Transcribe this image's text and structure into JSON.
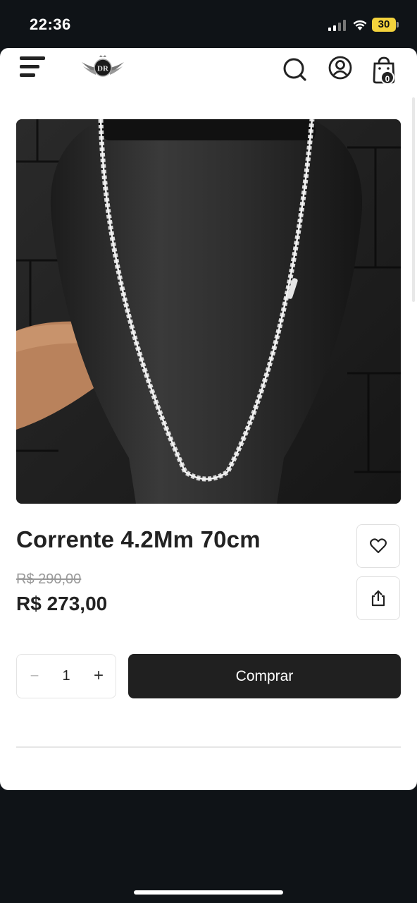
{
  "status_bar": {
    "time": "22:36",
    "battery": "30",
    "icons": [
      "signal-icon",
      "wifi-icon",
      "battery-icon"
    ],
    "battery_color": "#f3d23c"
  },
  "header": {
    "logo_text": "DR",
    "icons": [
      "menu-icon",
      "search-icon",
      "account-icon",
      "cart-icon"
    ],
    "cart_count": "0"
  },
  "product": {
    "title": "Corrente 4.2Mm 70cm",
    "price_old": "R$ 290,00",
    "price_current": "R$ 273,00",
    "quantity": "1",
    "buy_label": "Comprar",
    "actions": [
      "heart-icon",
      "share-icon"
    ]
  },
  "colors": {
    "accent": "#202020",
    "background": "#ffffff",
    "outer": "#0f1317"
  }
}
